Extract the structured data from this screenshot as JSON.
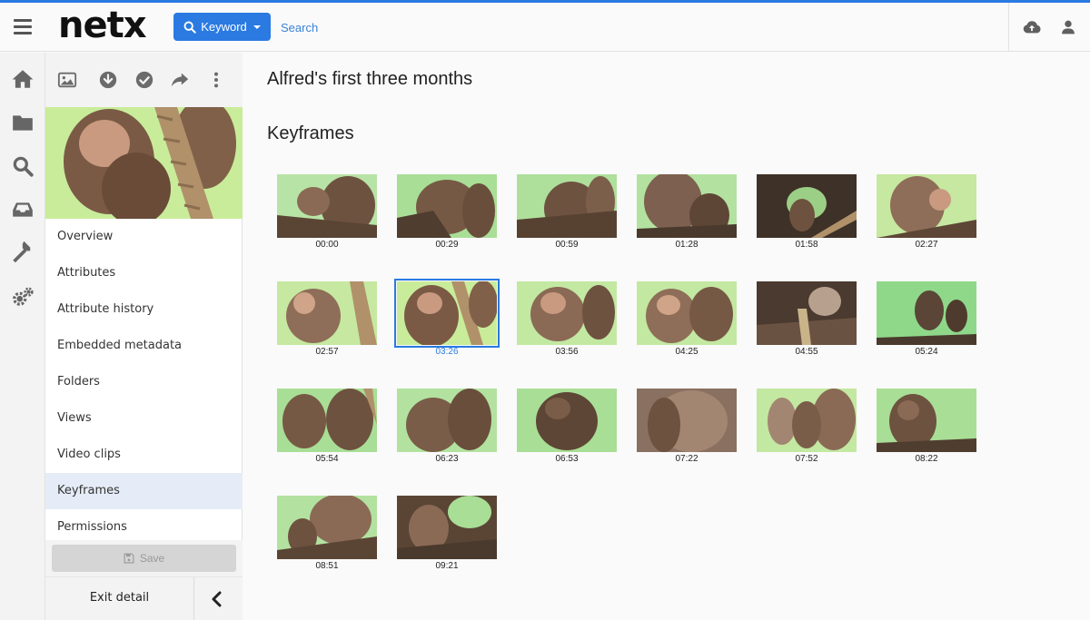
{
  "header": {
    "logo": "netx",
    "keyword_button": "Keyword",
    "search_placeholder": "Search"
  },
  "panel": {
    "nav": [
      "Overview",
      "Attributes",
      "Attribute history",
      "Embedded metadata",
      "Folders",
      "Views",
      "Video clips",
      "Keyframes",
      "Permissions"
    ],
    "active_nav": "Keyframes",
    "save_label": "Save",
    "exit_label": "Exit detail"
  },
  "main": {
    "asset_title": "Alfred's first three months",
    "section_title": "Keyframes",
    "keyframes": [
      "00:00",
      "00:29",
      "00:59",
      "01:28",
      "01:58",
      "02:27",
      "02:57",
      "03:26",
      "03:56",
      "04:25",
      "04:55",
      "05:24",
      "05:54",
      "06:23",
      "06:53",
      "07:22",
      "07:52",
      "08:22",
      "08:51",
      "09:21"
    ],
    "selected_keyframe": "03:26"
  },
  "colors": {
    "accent": "#2a7ae2",
    "active_nav_bg": "#e6ecf7",
    "icon_gray": "#6b6b6b"
  }
}
